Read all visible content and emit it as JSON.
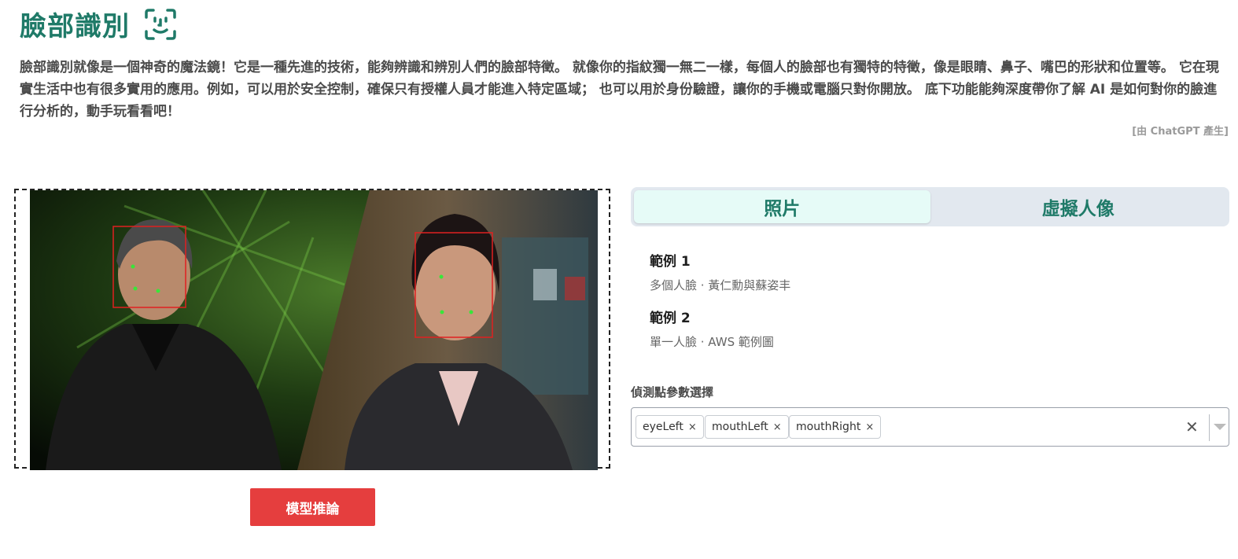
{
  "header": {
    "title": "臉部識別",
    "icon": "face-scan-icon"
  },
  "intro": {
    "text": "臉部識別就像是一個神奇的魔法鏡！它是一種先進的技術，能夠辨識和辨別人們的臉部特徵。 就像你的指紋獨一無二一樣，每個人的臉部也有獨特的特徵，像是眼睛、鼻子、嘴巴的形狀和位置等。 它在現實生活中也有很多實用的應用。例如，可以用於安全控制，確保只有授權人員才能進入特定區域； 也可以用於身份驗證，讓你的手機或電腦只對你開放。 底下功能能夠深度帶你了解 AI 是如何對你的臉進行分析的，動手玩看看吧！",
    "credit": "[由 ChatGPT 產生]"
  },
  "image_panel": {
    "infer_button": "模型推論"
  },
  "tabs": [
    {
      "label": "照片",
      "active": true
    },
    {
      "label": "虛擬人像",
      "active": false
    }
  ],
  "examples": [
    {
      "title": "範例 1",
      "desc": "多個人臉 · 黃仁勳與蘇姿丰"
    },
    {
      "title": "範例 2",
      "desc": "單一人臉 · AWS 範例圖"
    }
  ],
  "params": {
    "label": "偵測點參數選擇",
    "selected": [
      "eyeLeft",
      "mouthLeft",
      "mouthRight"
    ],
    "remove_symbol": "×",
    "clear_symbol": "✕"
  },
  "colors": {
    "accent": "#1f7a68",
    "button": "#e53e3e",
    "box": "#e02020",
    "landmark": "#39e639"
  }
}
